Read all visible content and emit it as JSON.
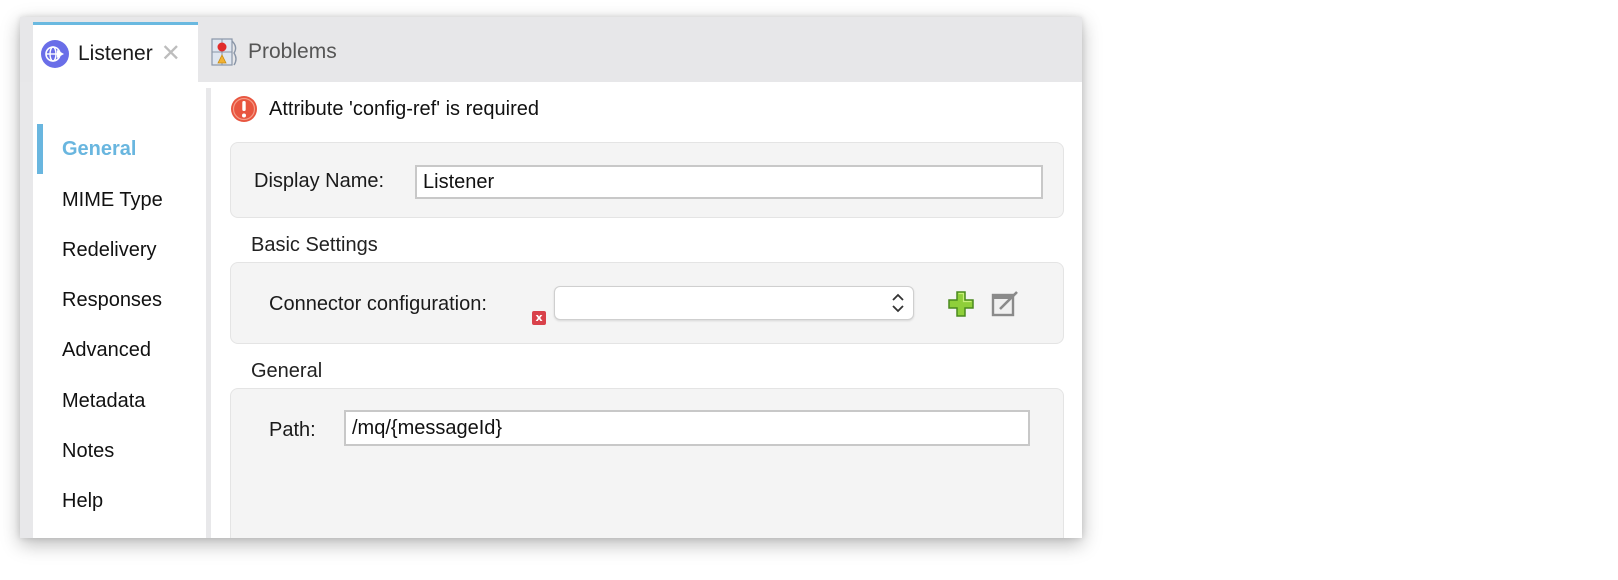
{
  "tabs": [
    {
      "label": "Listener",
      "icon": "listener-globe-icon",
      "active": true,
      "closable": true,
      "close_glyph": "✕"
    },
    {
      "label": "Problems",
      "icon": "problems-icon",
      "active": false,
      "closable": false
    }
  ],
  "sidebar": {
    "items": [
      {
        "label": "General",
        "active": true
      },
      {
        "label": "MIME Type",
        "active": false
      },
      {
        "label": "Redelivery",
        "active": false
      },
      {
        "label": "Responses",
        "active": false
      },
      {
        "label": "Advanced",
        "active": false
      },
      {
        "label": "Metadata",
        "active": false
      },
      {
        "label": "Notes",
        "active": false
      },
      {
        "label": "Help",
        "active": false
      }
    ]
  },
  "error": {
    "message": "Attribute 'config-ref' is required",
    "icon": "error-icon"
  },
  "form": {
    "display_name": {
      "label": "Display Name:",
      "value": "Listener"
    },
    "basic_settings": {
      "title": "Basic Settings",
      "connector_configuration": {
        "label": "Connector configuration:",
        "value": "",
        "required_marker": "x"
      },
      "add_button_icon": "add-icon",
      "edit_button_icon": "edit-icon"
    },
    "general": {
      "title": "General",
      "path": {
        "label": "Path:",
        "value": "/mq/{messageId}"
      }
    }
  },
  "colors": {
    "accent": "#69b6df",
    "error": "#e0443a",
    "required_marker": "#d9414a",
    "add_green": "#7cc242"
  }
}
